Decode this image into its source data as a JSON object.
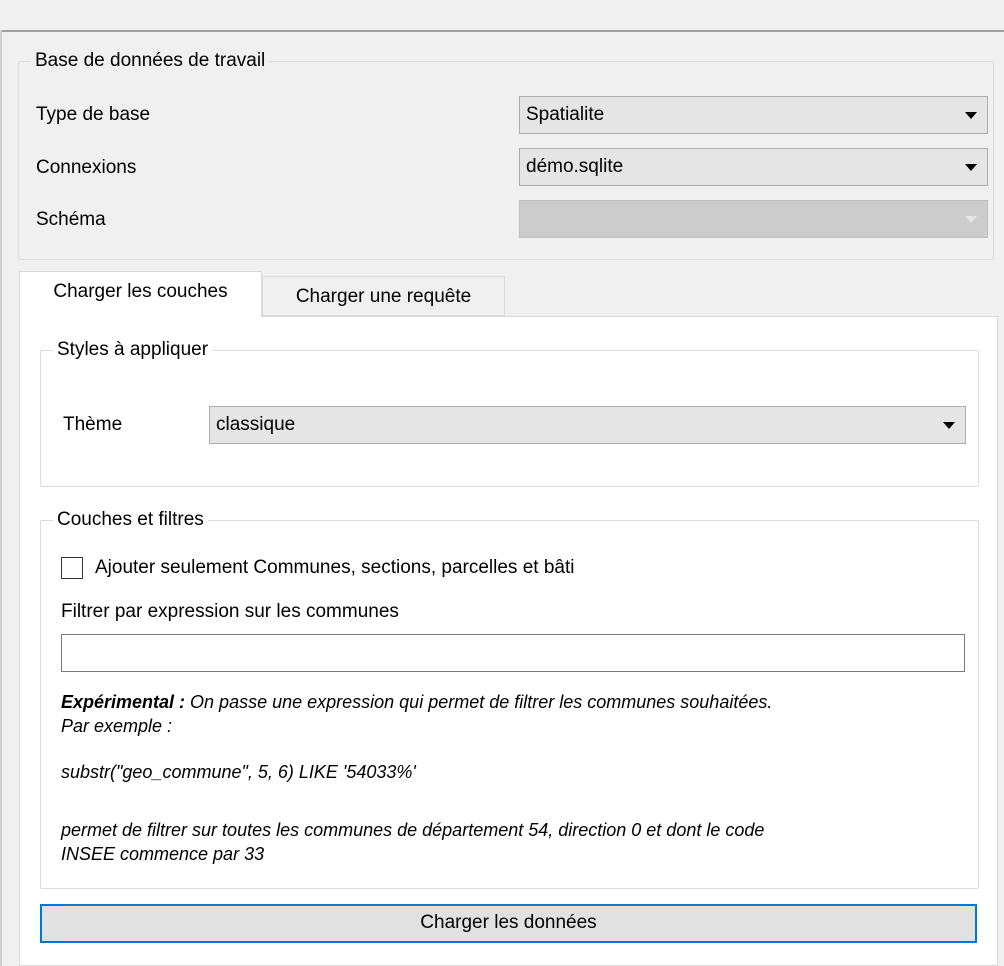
{
  "database_group": {
    "title": "Base de données de travail",
    "rows": [
      {
        "label": "Type de base",
        "value": "Spatialite"
      },
      {
        "label": "Connexions",
        "value": "démo.sqlite"
      },
      {
        "label": "Schéma",
        "value": ""
      }
    ]
  },
  "tabs": [
    {
      "label": "Charger les couches",
      "active": true
    },
    {
      "label": "Charger une requête",
      "active": false
    }
  ],
  "styles_group": {
    "title": "Styles à appliquer",
    "theme_label": "Thème",
    "theme_value": "classique"
  },
  "layers_group": {
    "title": "Couches et filtres",
    "checkbox_label": "Ajouter seulement Communes, sections, parcelles et bâti",
    "checkbox_checked": false,
    "filter_label": "Filtrer par expression sur les communes",
    "filter_value": "",
    "note_bold": "Expérimental :",
    "note_line1": " On passe une expression qui permet de filtrer les communes souhaitées.",
    "note_line2": "Par exemple :",
    "note_example": "substr(\"geo_commune\", 5, 6) LIKE '54033%'",
    "note_explain1": "permet de filtrer sur toutes les communes de département 54, direction 0 et dont le code",
    "note_explain2": "INSEE commence par 33"
  },
  "load_button": {
    "label": "Charger les données"
  },
  "colors": {
    "accent": "#0078d7",
    "window_bg": "#f0f0f0",
    "pane_bg": "#ffffff"
  }
}
